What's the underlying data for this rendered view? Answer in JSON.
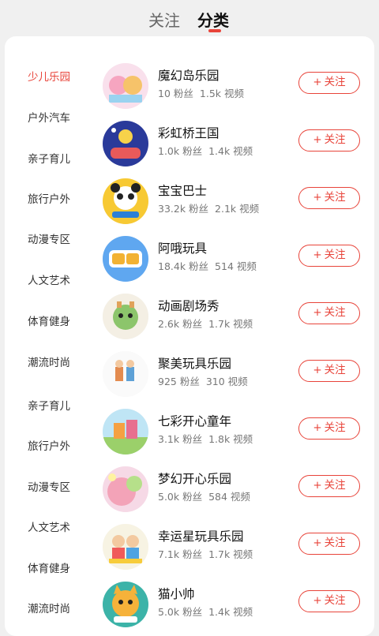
{
  "tabs": {
    "follow": "关注",
    "category": "分类"
  },
  "categories": [
    "少儿乐园",
    "户外汽车",
    "亲子育儿",
    "旅行户外",
    "动漫专区",
    "人文艺术",
    "体育健身",
    "潮流时尚",
    "亲子育儿",
    "旅行户外",
    "动漫专区",
    "人文艺术",
    "体育健身",
    "潮流时尚"
  ],
  "follow_label": "关注",
  "channels": [
    {
      "name": "魔幻岛乐园",
      "fans": "10 粉丝",
      "videos": "1.5k 视频"
    },
    {
      "name": "彩虹桥王国",
      "fans": "1.0k 粉丝",
      "videos": "1.4k 视频"
    },
    {
      "name": "宝宝巴士",
      "fans": "33.2k 粉丝",
      "videos": "2.1k 视频"
    },
    {
      "name": "阿哦玩具",
      "fans": "18.4k 粉丝",
      "videos": "514 视频"
    },
    {
      "name": "动画剧场秀",
      "fans": "2.6k 粉丝",
      "videos": "1.7k 视频"
    },
    {
      "name": "聚美玩具乐园",
      "fans": "925 粉丝",
      "videos": "310 视频"
    },
    {
      "name": "七彩开心童年",
      "fans": "3.1k 粉丝",
      "videos": "1.8k 视频"
    },
    {
      "name": "梦幻开心乐园",
      "fans": "5.0k 粉丝",
      "videos": "584 视频"
    },
    {
      "name": "幸运星玩具乐园",
      "fans": "7.1k 粉丝",
      "videos": "1.7k 视频"
    },
    {
      "name": "猫小帅",
      "fans": "5.0k 粉丝",
      "videos": "1.4k 视频"
    }
  ],
  "colors": {
    "accent": "#e8443a"
  }
}
